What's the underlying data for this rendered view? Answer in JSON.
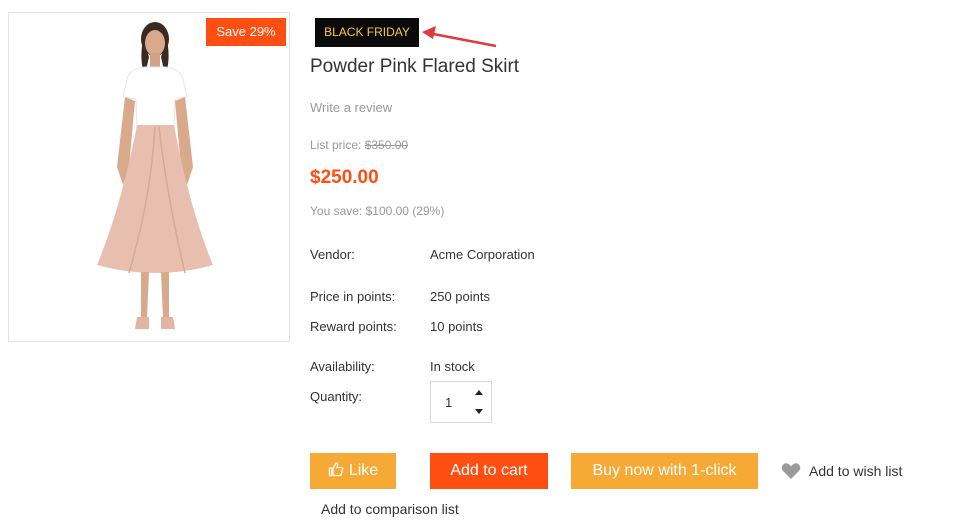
{
  "product": {
    "save_badge": "Save 29%",
    "promo_badge": "BLACK FRIDAY",
    "title": "Powder Pink Flared Skirt",
    "review_link": "Write a review",
    "list_price_label": "List price:",
    "list_price": "$350.00",
    "price": "$250.00",
    "you_save": "You save: $100.00 (29%)"
  },
  "properties": {
    "vendor_label": "Vendor:",
    "vendor_value": "Acme Corporation",
    "points_price_label": "Price in points:",
    "points_price_value": "250 points",
    "reward_label": "Reward points:",
    "reward_value": "10 points",
    "availability_label": "Availability:",
    "availability_value": "In stock",
    "quantity_label": "Quantity:",
    "quantity_value": "1"
  },
  "actions": {
    "like": "Like",
    "add_to_cart": "Add to cart",
    "buy_now": "Buy now with 1-click",
    "wishlist": "Add to wish list",
    "compare": "Add to comparison list"
  },
  "colors": {
    "accent_orange": "#ff4e12",
    "button_yellow": "#f7a936",
    "promo_bg": "#0a0a0a",
    "promo_text": "#ffc935",
    "annotation_red": "#e0393e"
  },
  "icons": {
    "like": "thumbs-up-icon",
    "wishlist": "heart-icon",
    "arrow": "annotation-arrow-icon"
  }
}
